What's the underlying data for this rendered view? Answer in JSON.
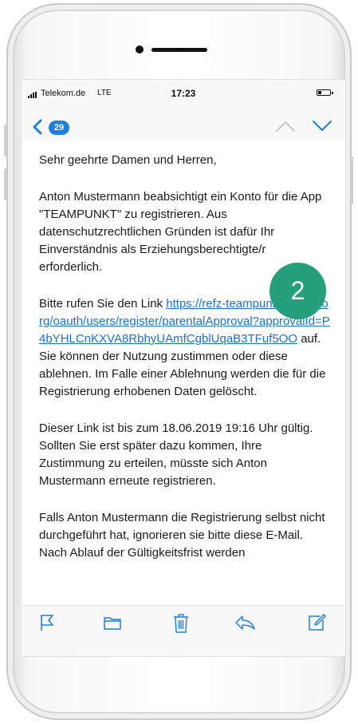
{
  "status_bar": {
    "carrier": "Telekom.de",
    "network": "LTE",
    "time": "17:23",
    "battery_level": 0.3
  },
  "nav": {
    "unread_count": "29",
    "back_icon": "chevron-left-icon",
    "up_icon": "chevron-up-icon",
    "down_icon": "chevron-down-icon"
  },
  "email": {
    "greeting": "Sehr geehrte Damen und Herren,",
    "paragraph1": "Anton Mustermann beabsichtigt ein Konto für die App \"TEAMPUNKT\" zu registrieren. Aus datenschutzrechtlichen Gründen ist dafür Ihr Einverständnis als Erziehungsberechtigte/r erforderlich.",
    "paragraph2_prefix": "Bitte rufen Sie den Link ",
    "link": "https://refz-teampunkt.dfbnet.org/oauth/users/register/parentalApproval?approvalId=P4bYHLCnKXVA8RbhyUAmfCgblUqaB3TFuf5OO",
    "paragraph2_suffix": " auf. Sie können der Nutzung zustimmen oder diese ablehnen. Im Falle einer Ablehnung werden die für die Registrierung erhobenen Daten gelöscht.",
    "paragraph3": "Dieser Link ist bis zum 18.06.2019 19:16 Uhr gültig. Sollten Sie erst später dazu kommen, Ihre Zustimmung zu erteilen, müsste sich Anton Mustermann erneute registrieren.",
    "paragraph4": "Falls Anton Mustermann die Registrierung selbst nicht durchgeführt hat, ignorieren sie bitte diese E-Mail. Nach Ablauf der Gültigkeitsfrist werden"
  },
  "step_marker": "2",
  "toolbar": {
    "icons": [
      "flag-icon",
      "folder-icon",
      "trash-icon",
      "reply-icon",
      "compose-icon"
    ]
  },
  "colors": {
    "accent": "#1e7fe0",
    "link": "#1873d3",
    "step_badge": "#26a07c"
  }
}
